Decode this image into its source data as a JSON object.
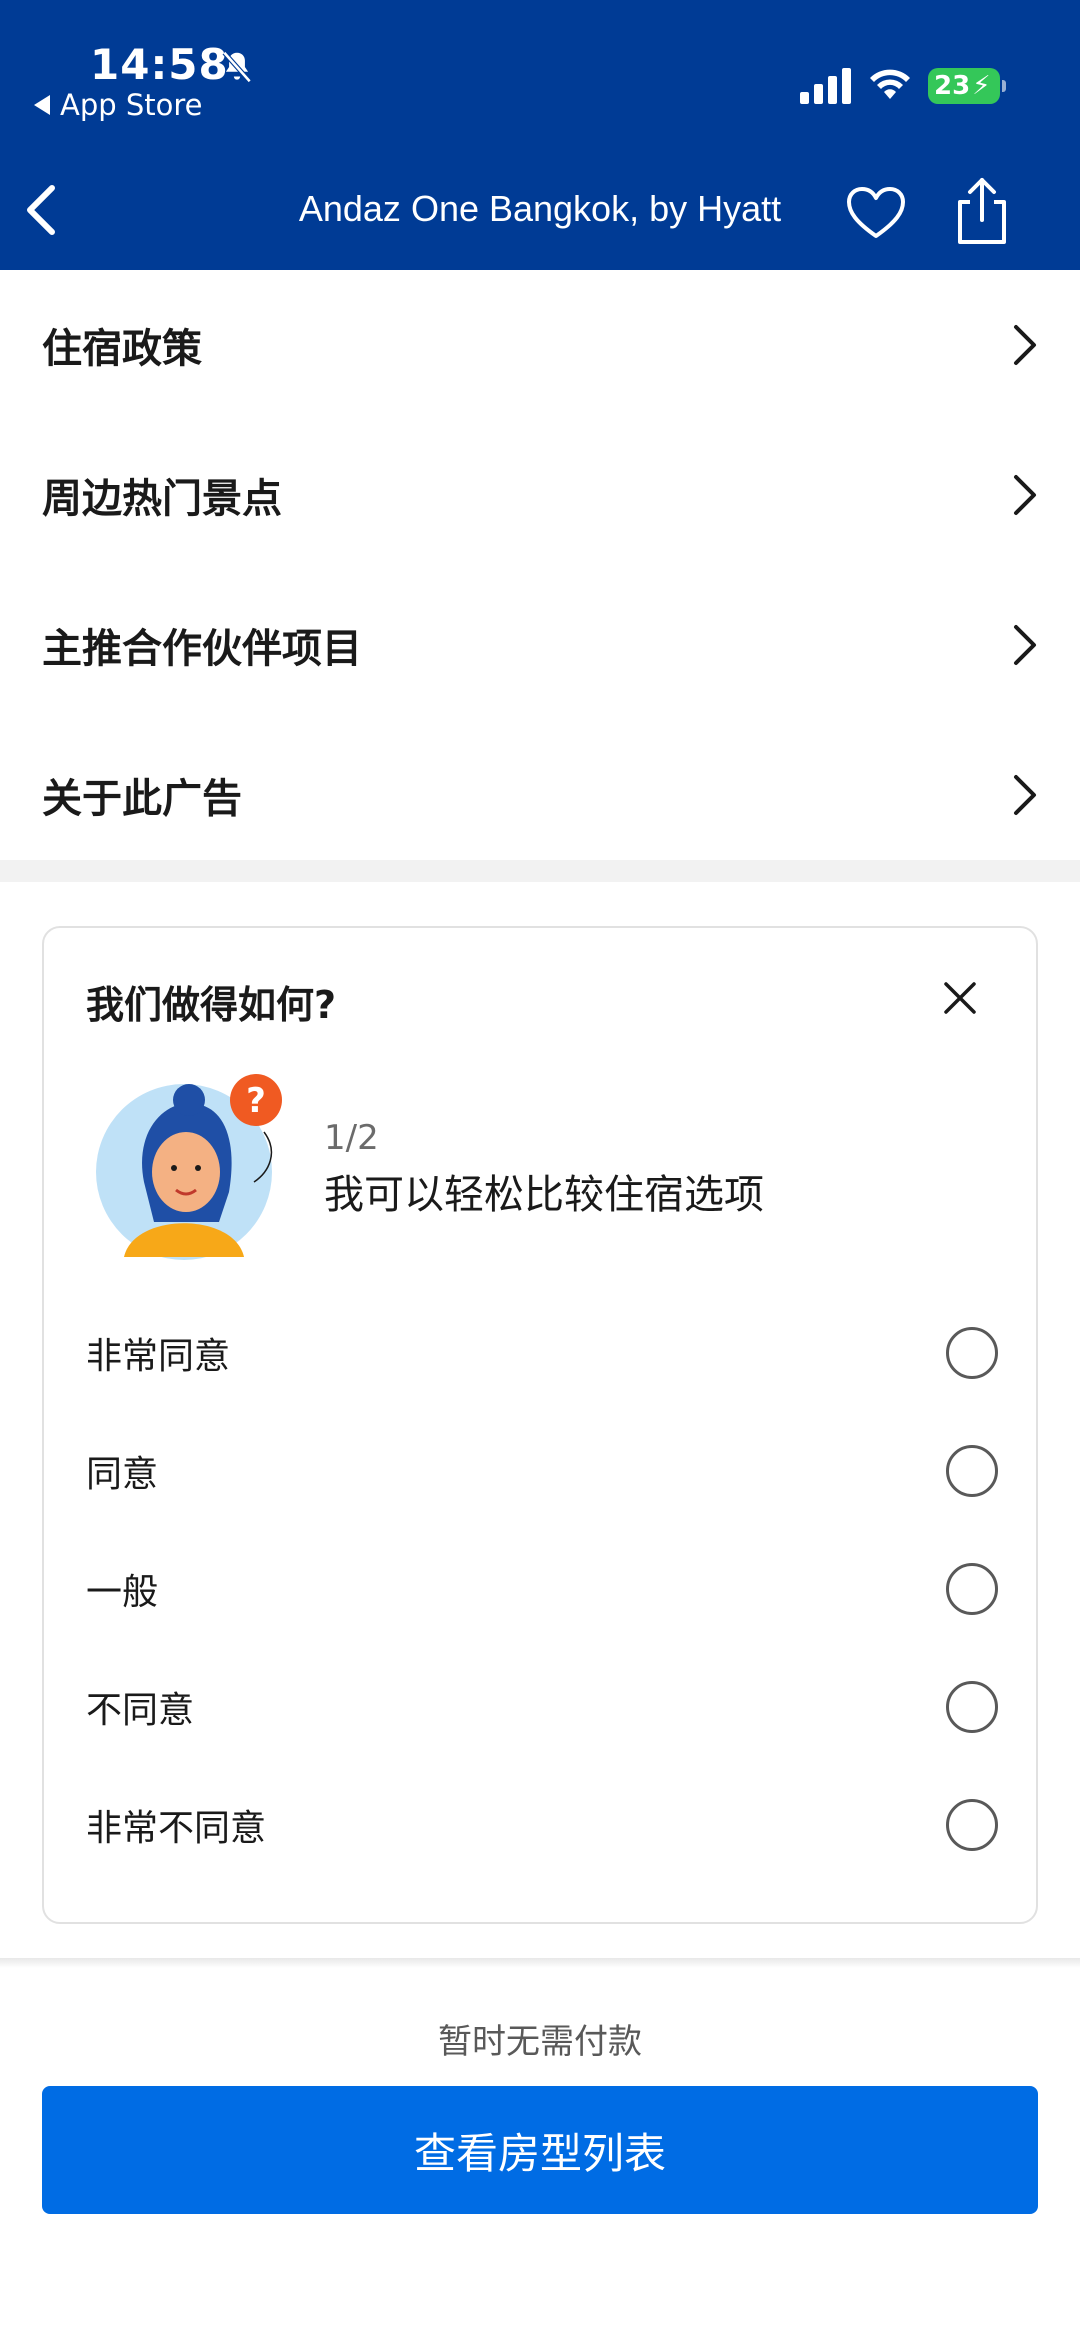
{
  "status_bar": {
    "time": "14:58",
    "back_app": "App Store",
    "battery": "23"
  },
  "nav": {
    "title": "Andaz One Bangkok, by Hyatt"
  },
  "menu": {
    "items": [
      {
        "label": "住宿政策"
      },
      {
        "label": "周边热门景点"
      },
      {
        "label": "主推合作伙伴项目"
      },
      {
        "label": "关于此广告"
      }
    ]
  },
  "survey": {
    "title": "我们做得如何?",
    "step": "1/2",
    "question": "我可以轻松比较住宿选项",
    "options": [
      {
        "label": "非常同意"
      },
      {
        "label": "同意"
      },
      {
        "label": "一般"
      },
      {
        "label": "不同意"
      },
      {
        "label": "非常不同意"
      }
    ]
  },
  "footer": {
    "pay_note": "暂时无需付款",
    "cta_label": "查看房型列表"
  },
  "colors": {
    "header_bg": "#003b95",
    "cta_bg": "#006ce4",
    "battery": "#34c759"
  },
  "icons": [
    "bell-slash-icon",
    "signal-icon",
    "wifi-icon",
    "battery-icon",
    "back-arrow-icon",
    "heart-icon",
    "share-icon",
    "chevron-right-icon",
    "close-icon"
  ]
}
